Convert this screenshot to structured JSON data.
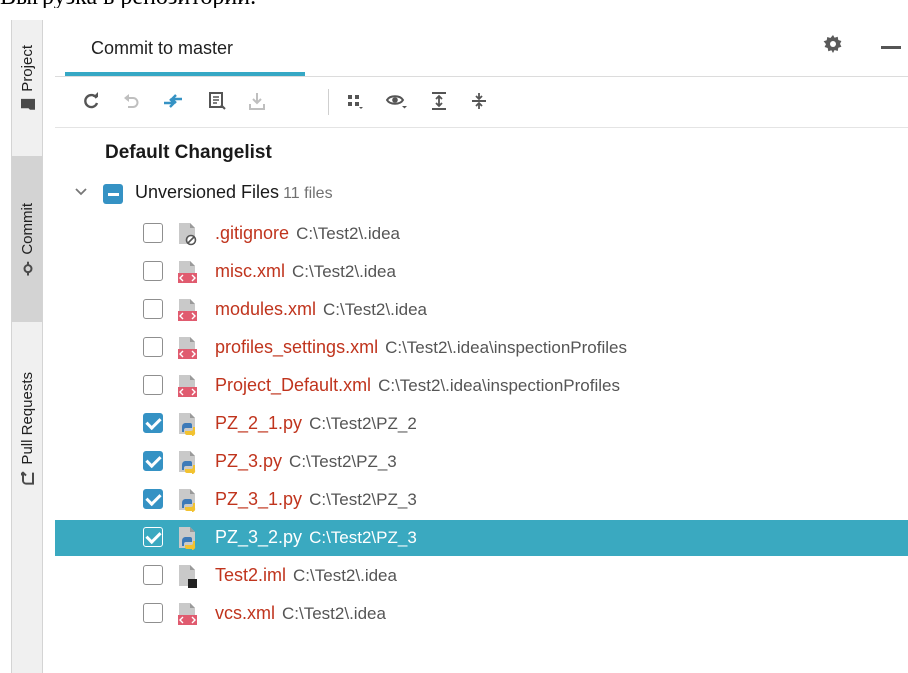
{
  "top_text": "Выгрузка в репозиторий.",
  "sidebar": {
    "tabs": [
      {
        "label": "Project",
        "icon": "folder-icon"
      },
      {
        "label": "Commit",
        "icon": "commit-icon"
      },
      {
        "label": "Pull Requests",
        "icon": "pull-request-icon"
      }
    ],
    "active_tab": "Commit"
  },
  "header": {
    "title": "Commit to master",
    "icons": [
      "gear-icon",
      "minimize-icon"
    ]
  },
  "toolbar": {
    "buttons": [
      {
        "icon": "refresh-icon",
        "enabled": true
      },
      {
        "icon": "rollback-icon",
        "enabled": false
      },
      {
        "icon": "diff-icon",
        "enabled": true
      },
      {
        "icon": "shelve-icon",
        "enabled": true
      },
      {
        "icon": "update-icon",
        "enabled": false
      },
      {
        "icon": "group-by-icon",
        "enabled": true
      },
      {
        "icon": "view-options-icon",
        "enabled": true
      },
      {
        "icon": "expand-all-icon",
        "enabled": true
      },
      {
        "icon": "collapse-all-icon",
        "enabled": true
      }
    ]
  },
  "changelist": {
    "title": "Default Changelist",
    "group": {
      "label": "Unversioned Files",
      "count": "11 files",
      "files": [
        {
          "name": ".gitignore",
          "path": "C:\\Test2\\.idea",
          "checked": false,
          "icon": "gitignore-file-icon"
        },
        {
          "name": "misc.xml",
          "path": "C:\\Test2\\.idea",
          "checked": false,
          "icon": "xml-file-icon"
        },
        {
          "name": "modules.xml",
          "path": "C:\\Test2\\.idea",
          "checked": false,
          "icon": "xml-file-icon"
        },
        {
          "name": "profiles_settings.xml",
          "path": "C:\\Test2\\.idea\\inspectionProfiles",
          "checked": false,
          "icon": "xml-file-icon"
        },
        {
          "name": "Project_Default.xml",
          "path": "C:\\Test2\\.idea\\inspectionProfiles",
          "checked": false,
          "icon": "xml-file-icon"
        },
        {
          "name": "PZ_2_1.py",
          "path": "C:\\Test2\\PZ_2",
          "checked": true,
          "icon": "python-file-icon"
        },
        {
          "name": "PZ_3.py",
          "path": "C:\\Test2\\PZ_3",
          "checked": true,
          "icon": "python-file-icon"
        },
        {
          "name": "PZ_3_1.py",
          "path": "C:\\Test2\\PZ_3",
          "checked": true,
          "icon": "python-file-icon"
        },
        {
          "name": "PZ_3_2.py",
          "path": "C:\\Test2\\PZ_3",
          "checked": true,
          "icon": "python-file-icon",
          "selected": true
        },
        {
          "name": "Test2.iml",
          "path": "C:\\Test2\\.idea",
          "checked": false,
          "icon": "iml-file-icon"
        },
        {
          "name": "vcs.xml",
          "path": "C:\\Test2\\.idea",
          "checked": false,
          "icon": "xml-file-icon"
        }
      ]
    }
  },
  "colors": {
    "accent": "#3592c4",
    "selection": "#3aa9c0",
    "tab_underline": "#36a8c5",
    "unversioned_text": "#c0341d"
  }
}
